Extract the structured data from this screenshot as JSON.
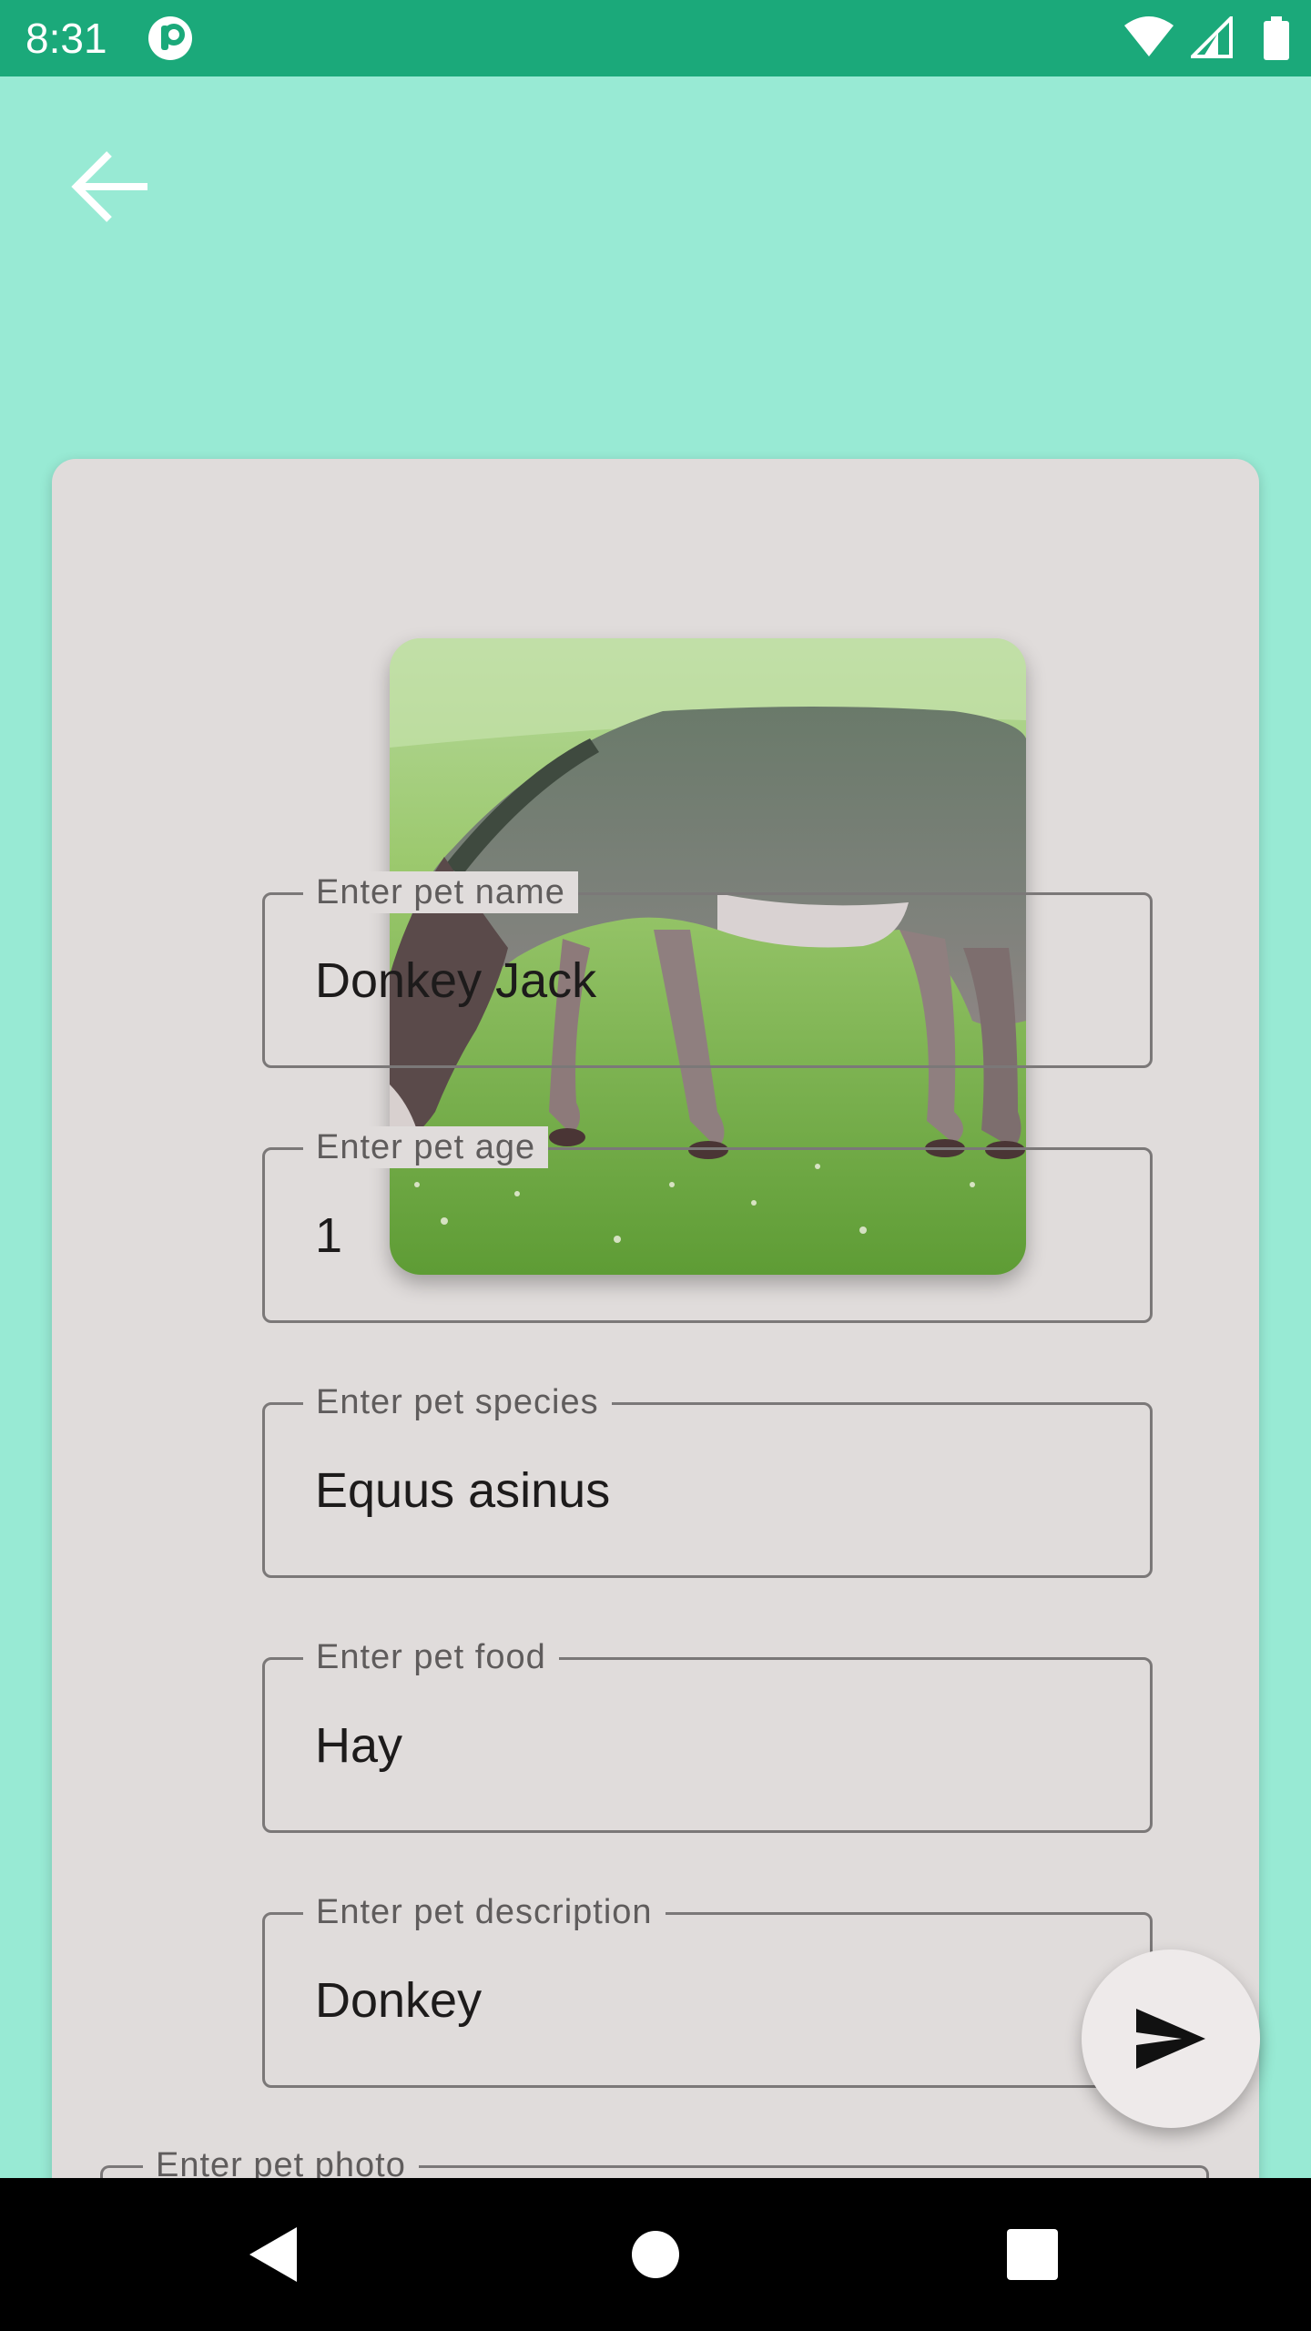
{
  "status_bar": {
    "time": "8:31",
    "icons": [
      "app-notification-icon",
      "wifi-icon",
      "cell-signal-icon",
      "battery-icon"
    ]
  },
  "header": {
    "back_icon": "arrow-back-icon"
  },
  "pet_photo": {
    "subject": "donkey"
  },
  "form": {
    "name": {
      "label": "Enter pet name",
      "value": "Donkey Jack"
    },
    "age": {
      "label": "Enter pet age",
      "value": "1"
    },
    "species": {
      "label": "Enter pet species",
      "value": "Equus asinus"
    },
    "food": {
      "label": "Enter pet food",
      "value": "Hay"
    },
    "description": {
      "label": "Enter pet description",
      "value": "Donkey"
    },
    "photo": {
      "label": "Enter pet photo"
    }
  },
  "fab": {
    "icon": "send-icon"
  },
  "nav_bar": {
    "icons": [
      "back-triangle-icon",
      "home-circle-icon",
      "recents-square-icon"
    ]
  },
  "colors": {
    "background": "#98ead4",
    "status_bar": "#1ba97a",
    "card": "#e0dcdb",
    "nav_bar": "#000000"
  }
}
